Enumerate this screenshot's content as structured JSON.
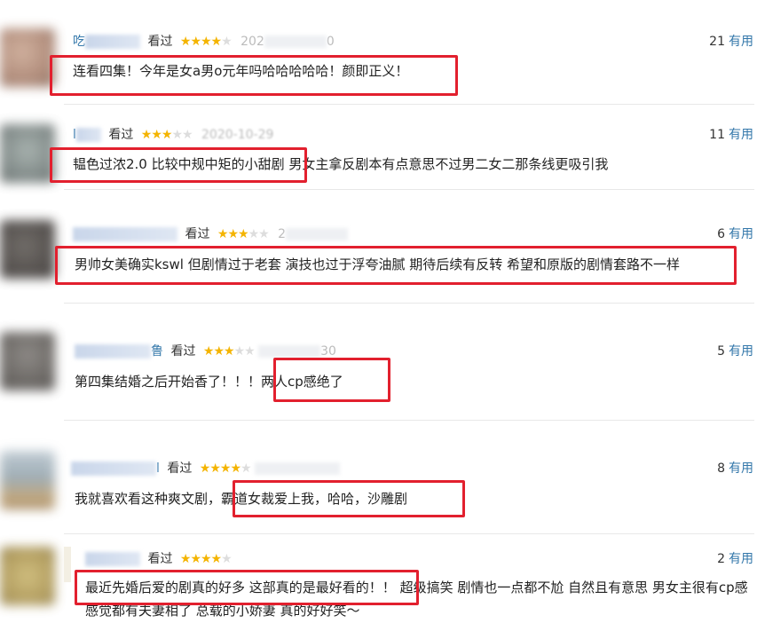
{
  "watched_label": "看过",
  "useful_label": "有用",
  "colors": {
    "link": "#3377aa",
    "star": "#f4b400",
    "highlight": "#e2202e"
  },
  "reviews": [
    {
      "user": "吃",
      "stars": 4,
      "date": "202",
      "date_tail": "0",
      "votes": "21",
      "content": "连看四集！今年是女a男o元年吗哈哈哈哈哈！颜即正义！"
    },
    {
      "user": "l",
      "stars": 3,
      "date": "2020-10-29",
      "votes": "11",
      "content_hl": "韫色过浓2.0 比较中规中矩的小甜剧",
      "content_rest": " 男女主拿反剧本有点意思不过男二女二那条线更吸引我"
    },
    {
      "user": "",
      "stars": 3,
      "date": "2",
      "votes": "6",
      "content": "男帅女美确实kswl 但剧情过于老套 演技也过于浮夸油腻 期待后续有反转 希望和原版的剧情套路不一样"
    },
    {
      "user": "鲁",
      "stars": 3,
      "date": "30",
      "votes": "5",
      "content_pre": "第四集结婚之后开始香了！！！",
      "content_hl": "两人cp感绝了"
    },
    {
      "user": "l",
      "stars": 4,
      "date": "",
      "votes": "8",
      "content_pre": "我就喜欢看这种爽文剧，",
      "content_hl": "霸道女裁爱上我，哈哈，沙雕剧"
    },
    {
      "user": "",
      "stars": 4,
      "date": "",
      "votes": "2",
      "content_hl": "最近先婚后爱的剧真的好多 这部真的是最好看的！！",
      "content_rest": "超级搞笑 剧情也一点都不尬 自然且有意思 男女主很有cp感 感觉都有夫妻相了 总载的小娇妻 真的好好笑～"
    }
  ]
}
